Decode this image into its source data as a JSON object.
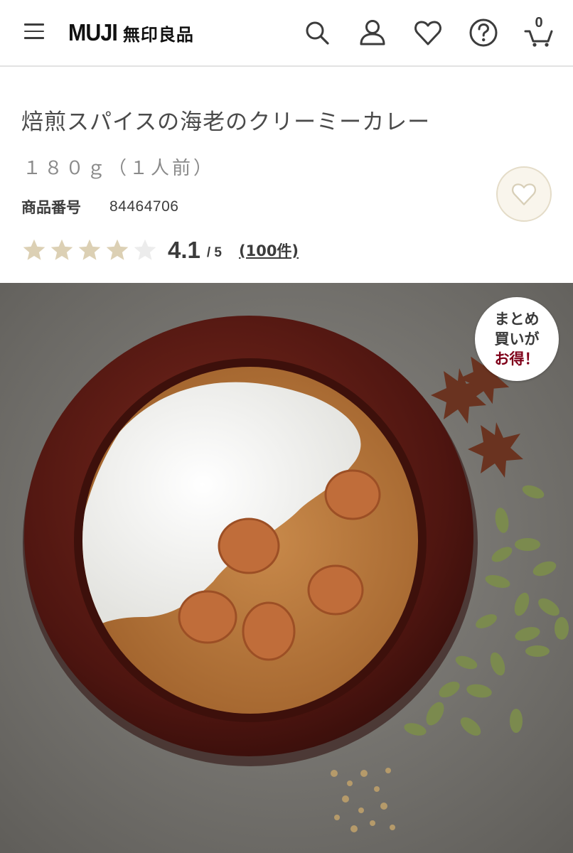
{
  "header": {
    "logo_en": "MUJI",
    "logo_jp": "無印良品",
    "cart_count": "0",
    "icons": [
      "menu-icon",
      "search-icon",
      "user-icon",
      "heart-icon",
      "help-icon",
      "cart-icon"
    ]
  },
  "product": {
    "title": "焙煎スパイスの海老のクリーミーカレー",
    "subtitle": "１８０ｇ（１人前）",
    "code_label": "商品番号",
    "code_value": "84464706",
    "rating": {
      "value": 4.1,
      "score_text": "4.1",
      "max_text": "/ 5",
      "stars_total": 5,
      "reviews_text": "(100件)"
    }
  },
  "promo_badge": {
    "line1": "まとめ",
    "line2": "買いが",
    "line3": "お得！"
  },
  "colors": {
    "star_filled": "#dcd0b4",
    "star_empty": "#ececec",
    "favorite_bg": "#f9f5ec",
    "badge_accent": "#7f0019",
    "bowl": "#5a1a12",
    "curry": "#b8773a"
  }
}
